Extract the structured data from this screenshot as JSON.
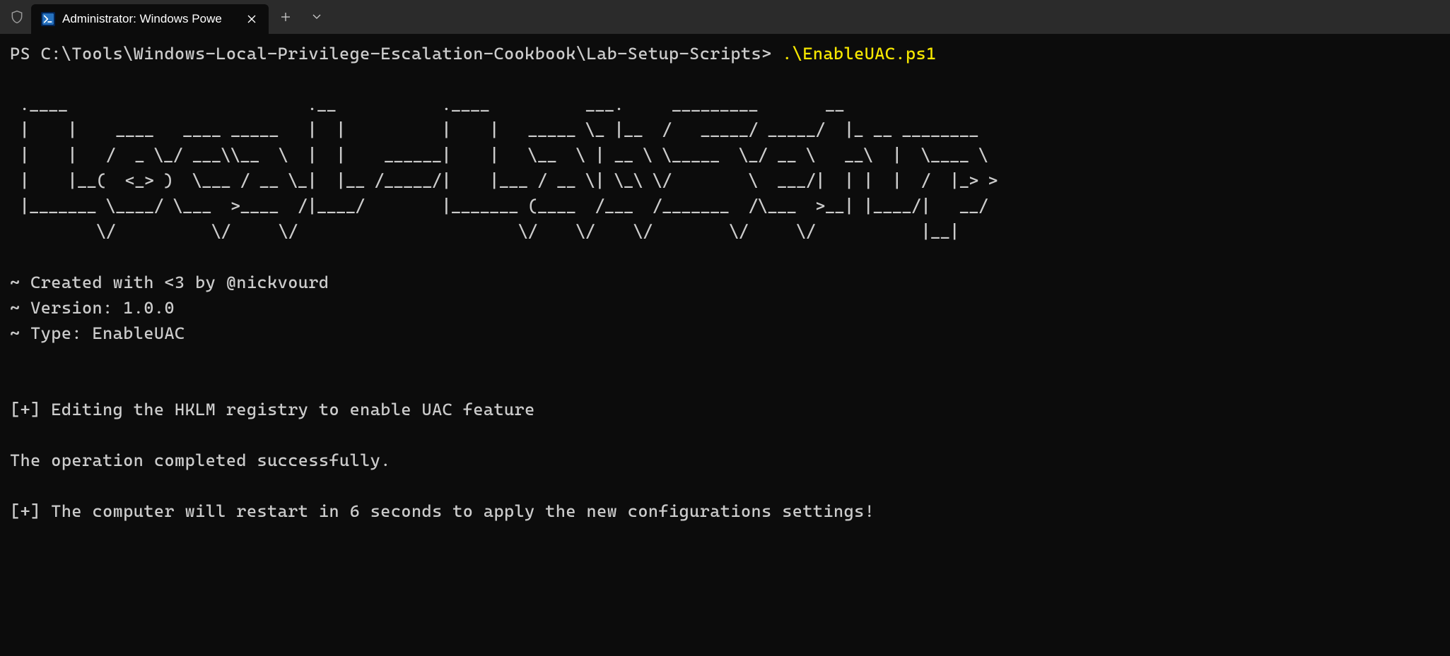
{
  "titlebar": {
    "tab_title": "Administrator: Windows Powe"
  },
  "terminal": {
    "prompt": "PS C:\\Tools\\Windows-Local-Privilege-Escalation-Cookbook\\Lab-Setup-Scripts> ",
    "command": ".\\EnableUAC.ps1",
    "ascii_art": " .____                         .__           .____          ___.     _________       __                 \n |    |    ____   ____ _____   |  |          |    |   _____ \\_ |__  /   _____/ _____/  |_ __ ________   \n |    |   /  _ \\_/ ___\\\\__  \\  |  |    ______|    |   \\__  \\ | __ \\ \\_____  \\_/ __ \\   __\\  |  \\____ \\  \n |    |__(  <_> )  \\___ / __ \\_|  |__ /_____/|    |___ / __ \\| \\_\\ \\/        \\  ___/|  | |  |  /  |_> > \n |_______ \\____/ \\___  >____  /|____/        |_______ (____  /___  /_______  /\\___  >__| |____/|   __/  \n         \\/          \\/     \\/                       \\/    \\/    \\/        \\/     \\/           |__|     ",
    "meta_created": "~ Created with <3 by @nickvourd",
    "meta_version": "~ Version: 1.0.0",
    "meta_type": "~ Type: EnableUAC",
    "action_line": "[+] Editing the HKLM registry to enable UAC feature",
    "success_line": "The operation completed successfully.",
    "restart_line": "[+] The computer will restart in 6 seconds to apply the new configurations settings!"
  }
}
